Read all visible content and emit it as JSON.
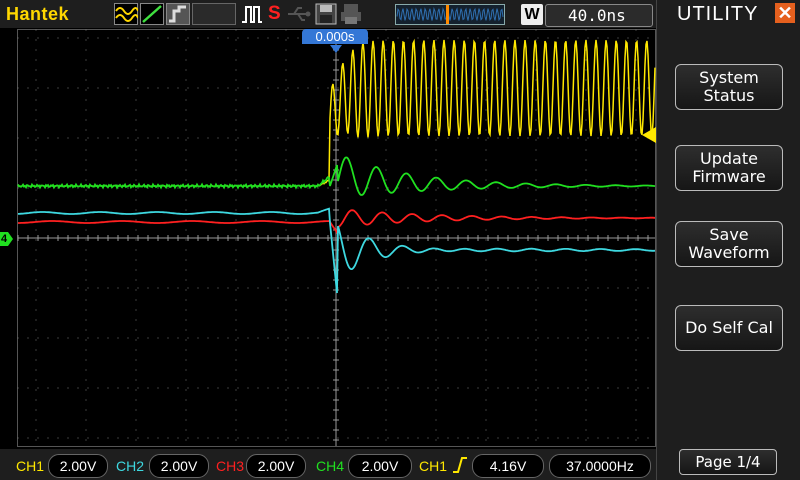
{
  "header": {
    "brand": "Hantek",
    "timebase_mode": "W",
    "timebase": "40.0ns",
    "icons": [
      "waveform-mode-icon",
      "line-mode-icon",
      "persistence-icon",
      "run-pulse-icon",
      "stop-icon",
      "usb-icon",
      "save-icon",
      "print-icon",
      "memory-position-icon"
    ],
    "run_state": "S"
  },
  "scope": {
    "trigger_time": "0.000s",
    "ch4_marker": "4"
  },
  "menu": {
    "title": "UTILITY",
    "items": [
      {
        "line1": "System",
        "line2": "Status"
      },
      {
        "line1": "Update",
        "line2": "Firmware"
      },
      {
        "line1": "Save",
        "line2": "Waveform"
      },
      {
        "line1": "Do Self Cal",
        "line2": ""
      }
    ],
    "page": "Page 1/4"
  },
  "status": {
    "channels": [
      {
        "name": "CH1",
        "scale": "2.00V",
        "color": "#ffe800"
      },
      {
        "name": "CH2",
        "scale": "2.00V",
        "color": "#3ed8e0"
      },
      {
        "name": "CH3",
        "scale": "2.00V",
        "color": "#ff2020"
      },
      {
        "name": "CH4",
        "scale": "2.00V",
        "color": "#20e020"
      }
    ],
    "trigger_source": "CH1",
    "trigger_level": "4.16V",
    "frequency": "37.0000Hz"
  },
  "colors": {
    "ch1": "#ffe800",
    "ch2": "#3ed8e0",
    "ch3": "#ff2020",
    "ch4": "#20e020",
    "accent": "#3477d6",
    "close": "#e5601e"
  }
}
